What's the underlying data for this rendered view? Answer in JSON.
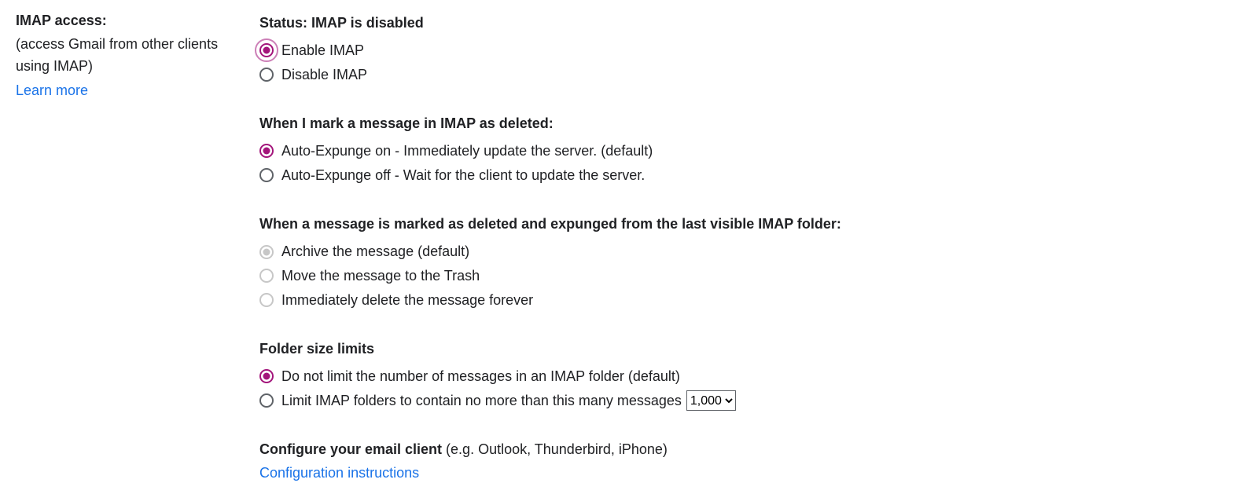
{
  "left": {
    "title": "IMAP access:",
    "description": "(access Gmail from other clients using IMAP)",
    "learn_more": "Learn more"
  },
  "status": {
    "heading": "Status: IMAP is disabled",
    "enable_label": "Enable IMAP",
    "disable_label": "Disable IMAP"
  },
  "delete_mark": {
    "heading": "When I mark a message in IMAP as deleted:",
    "opt_on": "Auto-Expunge on - Immediately update the server. (default)",
    "opt_off": "Auto-Expunge off - Wait for the client to update the server."
  },
  "expunged": {
    "heading": "When a message is marked as deleted and expunged from the last visible IMAP folder:",
    "opt_archive": "Archive the message (default)",
    "opt_trash": "Move the message to the Trash",
    "opt_delete": "Immediately delete the message forever"
  },
  "folder_limits": {
    "heading": "Folder size limits",
    "opt_nolimit": "Do not limit the number of messages in an IMAP folder (default)",
    "opt_limit": "Limit IMAP folders to contain no more than this many messages",
    "select_value": "1,000"
  },
  "configure": {
    "heading": "Configure your email client ",
    "hint": "(e.g. Outlook, Thunderbird, iPhone)",
    "link": "Configuration instructions"
  }
}
